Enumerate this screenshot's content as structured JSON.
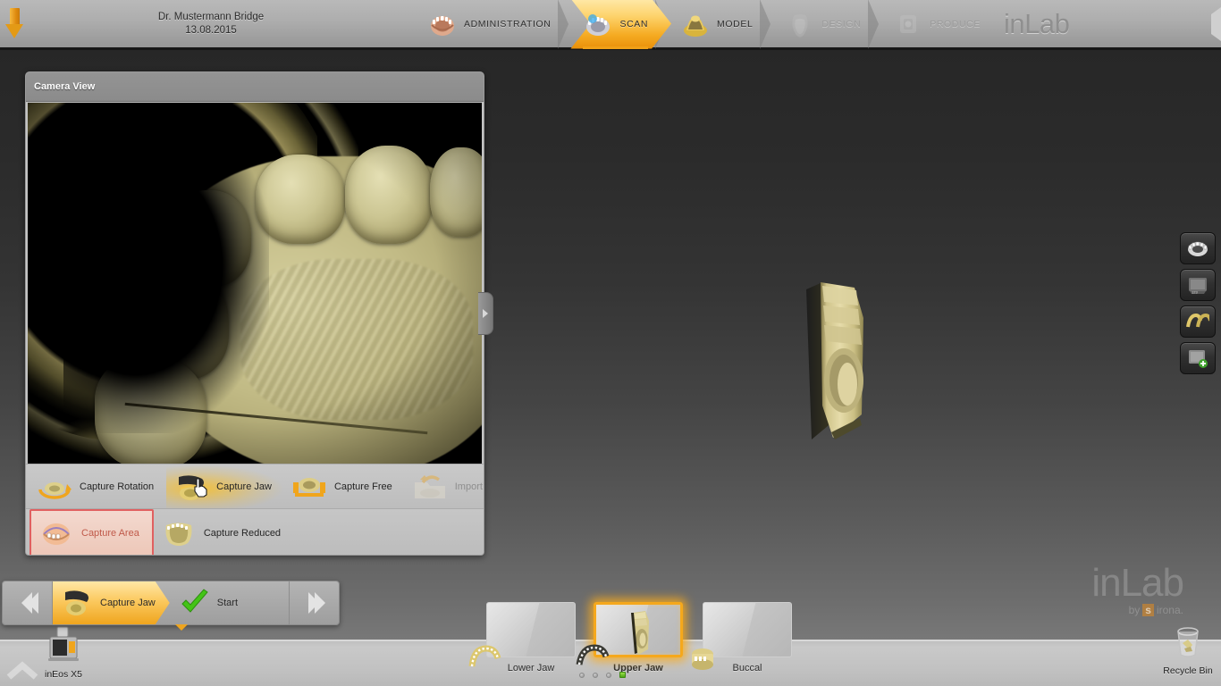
{
  "app": {
    "brand": "inLab",
    "watermark_main": "inLab",
    "watermark_by": "by",
    "watermark_s": "s",
    "watermark_rest": "irona."
  },
  "header": {
    "save_icon": "orange-down-arrow-icon",
    "patient_name": "Dr. Mustermann Bridge",
    "patient_date": "13.08.2015",
    "bolt_icon": "lightning-bolt-icon",
    "steps": [
      {
        "label": "ADMINISTRATION",
        "icon": "jaw-model-icon",
        "state": "done"
      },
      {
        "label": "SCAN",
        "icon": "scan-jaw-icon",
        "state": "active"
      },
      {
        "label": "MODEL",
        "icon": "gold-model-icon",
        "state": "done"
      },
      {
        "label": "DESIGN",
        "icon": "design-tooth-icon",
        "state": "disabled"
      },
      {
        "label": "PRODUCE",
        "icon": "milling-unit-icon",
        "state": "disabled"
      }
    ]
  },
  "camera_panel": {
    "title": "Camera View",
    "collapse_icon": "chevron-right-icon",
    "tools_row1": [
      {
        "label": "Capture Rotation",
        "icon": "capture-rotation-icon",
        "state": "normal"
      },
      {
        "label": "Capture Jaw",
        "icon": "capture-jaw-icon",
        "state": "hover"
      },
      {
        "label": "Capture Free",
        "icon": "capture-free-icon",
        "state": "normal"
      },
      {
        "label": "Import",
        "icon": "import-folder-icon",
        "state": "disabled"
      }
    ],
    "tools_row2": [
      {
        "label": "Capture Area",
        "icon": "capture-area-icon",
        "state": "selected"
      },
      {
        "label": "Capture Reduced",
        "icon": "capture-reduced-icon",
        "state": "normal"
      }
    ]
  },
  "right_rail": [
    {
      "name": "jaw-overview-icon",
      "label": "jaw-overview"
    },
    {
      "name": "screen-view-icon",
      "label": "screen-view"
    },
    {
      "name": "dual-jaw-icon",
      "label": "dual-jaw"
    },
    {
      "name": "add-image-icon",
      "label": "add-image"
    }
  ],
  "step_bar": {
    "back_label": "«",
    "forward_label": "»",
    "current_step": "Capture Jaw",
    "next_step": "Start",
    "current_icon": "capture-jaw-icon",
    "next_icon": "green-check-icon"
  },
  "jaw_strip": {
    "items": [
      {
        "label": "Lower Jaw",
        "selected": false,
        "has_scan": false
      },
      {
        "label": "Upper Jaw",
        "selected": true,
        "has_scan": true
      },
      {
        "label": "Buccal",
        "selected": false,
        "has_scan": false
      }
    ],
    "pager_dots": 4,
    "pager_active_index": 3
  },
  "desktop": {
    "scanner_label": "inEos X5",
    "scanner_icon": "scanner-device-icon",
    "recycle_label": "Recycle Bin",
    "recycle_icon": "recycle-bin-icon",
    "corner_icon": "chevron-up-icon"
  },
  "colors": {
    "accent_orange": "#efa51e",
    "active_step_gold": "#f5ab22",
    "selection_red": "#e06060",
    "viewport_dark": "#2a2a2a",
    "panel_grey": "#c4c4c4",
    "status_green": "#4da515"
  }
}
